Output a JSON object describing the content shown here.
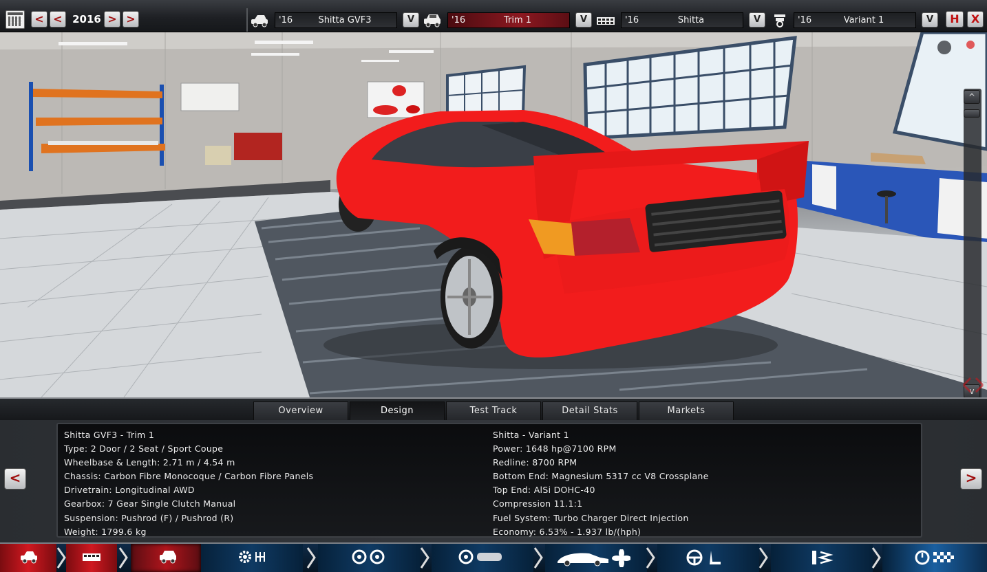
{
  "topbar": {
    "year": "2016",
    "prev_fast": "<",
    "prev": "<",
    "next": ">",
    "next_fast": ">",
    "model": {
      "year": "'16",
      "name": "Shitta GVF3",
      "dropdown": "V"
    },
    "trim": {
      "year": "'16",
      "name": "Trim 1",
      "dropdown": "V"
    },
    "engine_family": {
      "year": "'16",
      "name": "Shitta",
      "dropdown": "V"
    },
    "engine_variant": {
      "year": "'16",
      "name": "Variant 1",
      "dropdown": "V"
    },
    "save": "H",
    "close": "X"
  },
  "viewport": {
    "scroll_up": "^",
    "scroll_down": "v"
  },
  "tabs": [
    {
      "label": "Overview",
      "active": false
    },
    {
      "label": "Design",
      "active": true
    },
    {
      "label": "Test Track",
      "active": false
    },
    {
      "label": "Detail Stats",
      "active": false
    },
    {
      "label": "Markets",
      "active": false
    }
  ],
  "info": {
    "left": [
      "Shitta GVF3 - Trim 1",
      "Type: 2 Door / 2 Seat / Sport Coupe",
      "Wheelbase & Length: 2.71 m / 4.54 m",
      "Chassis: Carbon Fibre Monocoque / Carbon Fibre Panels",
      "Drivetrain: Longitudinal AWD",
      "Gearbox: 7 Gear Single Clutch Manual",
      "Suspension: Pushrod (F) / Pushrod (R)",
      "Weight: 1799.6 kg"
    ],
    "right": [
      "Shitta - Variant 1",
      "Power: 1648 hp@7100 RPM",
      "Redline: 8700 RPM",
      "Bottom End: Magnesium 5317 cc V8 Crossplane",
      "Top End: AlSi DOHC-40",
      "Compression 11.1:1",
      "Fuel System: Turbo Charger Direct Injection",
      "Economy: 6.53% - 1.937 lb/(hph)"
    ],
    "prev": "<",
    "next": ">"
  },
  "nav": {
    "segments": [
      {
        "id": "model",
        "icon": "car-model-icon"
      },
      {
        "id": "chassis",
        "icon": "chassis-icon"
      },
      {
        "id": "trim",
        "icon": "trim-car-icon",
        "active": true
      },
      {
        "id": "drivetrain",
        "icon": "gear-drivetrain-icon"
      },
      {
        "id": "wheels",
        "icon": "wheels-icon"
      },
      {
        "id": "brakes",
        "icon": "brakes-icon"
      },
      {
        "id": "body",
        "icon": "body-fan-icon"
      },
      {
        "id": "interior",
        "icon": "steering-seat-icon"
      },
      {
        "id": "suspension",
        "icon": "suspension-icon"
      },
      {
        "id": "testing",
        "icon": "gauge-flag-icon"
      }
    ]
  },
  "colors": {
    "accent_red": "#c8161d",
    "car_red": "#f41e1e",
    "nav_blue": "#0f3a63"
  }
}
